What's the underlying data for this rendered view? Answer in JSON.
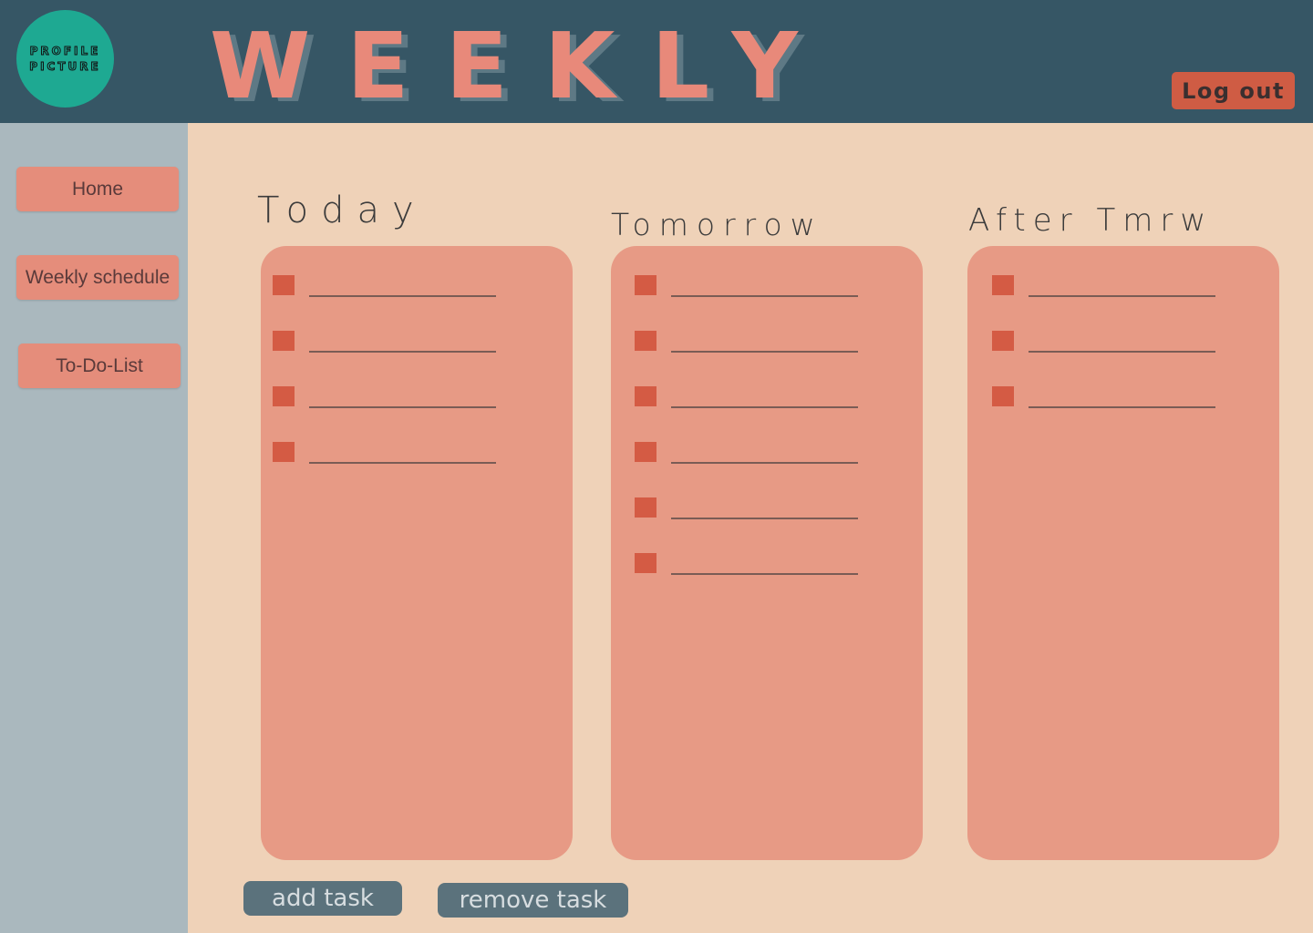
{
  "header": {
    "avatar_label": "PROFILE PICTURE",
    "brand": "WEEKLY",
    "logout_label": "Log out"
  },
  "sidebar": {
    "items": [
      {
        "label": "Home"
      },
      {
        "label": "Weekly schedule"
      },
      {
        "label": "To-Do-List"
      }
    ]
  },
  "columns": [
    {
      "title": "Today",
      "task_count": 4
    },
    {
      "title": "Tomorrow",
      "task_count": 6
    },
    {
      "title": "After Tmrw",
      "task_count": 3
    }
  ],
  "actions": {
    "add_label": "add task",
    "remove_label": "remove task"
  },
  "colors": {
    "header_bg": "#365665",
    "sidebar_bg": "#AAB8BE",
    "main_bg": "#EFD2B8",
    "panel_bg": "#E79A85",
    "checkbox": "#D45B44",
    "accent": "#CF5C44",
    "avatar": "#1EA992"
  }
}
